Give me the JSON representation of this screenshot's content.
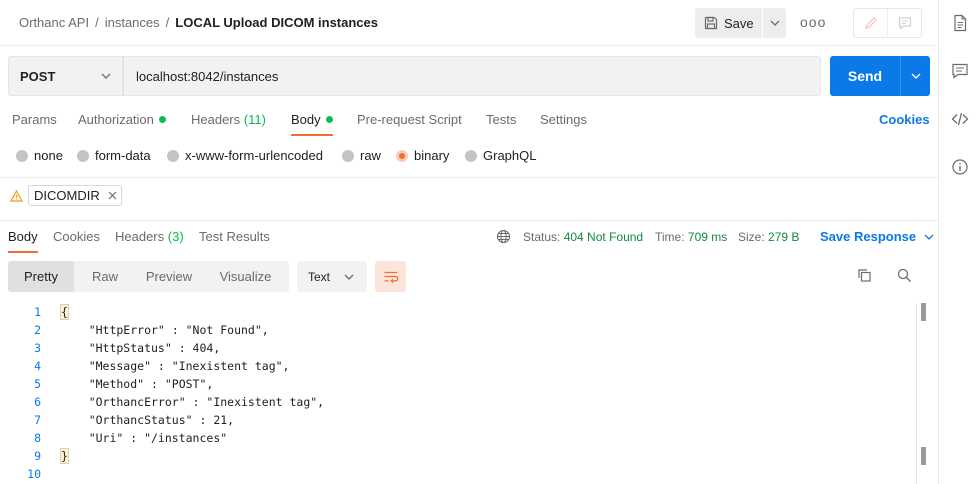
{
  "breadcrumb": {
    "parts": [
      "Orthanc API",
      "instances"
    ],
    "separator": "/",
    "current": "LOCAL Upload DICOM instances"
  },
  "header": {
    "save_label": "Save",
    "more_label": "ooo"
  },
  "request": {
    "method": "POST",
    "url": "localhost:8042/instances",
    "send_label": "Send"
  },
  "request_tabs": [
    {
      "label": "Params"
    },
    {
      "label": "Authorization"
    },
    {
      "label": "Headers",
      "count": "(11)"
    },
    {
      "label": "Body"
    },
    {
      "label": "Pre-request Script"
    },
    {
      "label": "Tests"
    },
    {
      "label": "Settings"
    }
  ],
  "cookies_label": "Cookies",
  "body_types": [
    "none",
    "form-data",
    "x-www-form-urlencoded",
    "raw",
    "binary",
    "GraphQL"
  ],
  "selected_body_type": "binary",
  "file": {
    "name": "DICOMDIR"
  },
  "response_tabs": [
    {
      "label": "Body"
    },
    {
      "label": "Cookies"
    },
    {
      "label": "Headers",
      "count": "(3)"
    },
    {
      "label": "Test Results"
    }
  ],
  "response_meta": {
    "status_label": "Status:",
    "status_value": "404 Not Found",
    "time_label": "Time:",
    "time_value": "709 ms",
    "size_label": "Size:",
    "size_value": "279 B",
    "save_response_label": "Save Response"
  },
  "view_modes": [
    "Pretty",
    "Raw",
    "Preview",
    "Visualize"
  ],
  "active_view": "Pretty",
  "format": "Text",
  "code_lines": [
    {
      "n": "1",
      "text": "{"
    },
    {
      "n": "2",
      "text": "    \"HttpError\" : \"Not Found\","
    },
    {
      "n": "3",
      "text": "    \"HttpStatus\" : 404,"
    },
    {
      "n": "4",
      "text": "    \"Message\" : \"Inexistent tag\","
    },
    {
      "n": "5",
      "text": "    \"Method\" : \"POST\","
    },
    {
      "n": "6",
      "text": "    \"OrthancError\" : \"Inexistent tag\","
    },
    {
      "n": "7",
      "text": "    \"OrthancStatus\" : 21,"
    },
    {
      "n": "8",
      "text": "    \"Uri\" : \"/instances\""
    },
    {
      "n": "9",
      "text": "}"
    },
    {
      "n": "10",
      "text": ""
    }
  ],
  "colors": {
    "accent": "#f26b3a",
    "primary": "#0c79e8",
    "success": "#0cbb52"
  },
  "icons": [
    "save-icon",
    "chevron-down-icon",
    "edit-icon",
    "comment-icon",
    "warning-icon",
    "close-icon",
    "globe-icon",
    "wrap-icon",
    "copy-icon",
    "search-icon",
    "document-icon",
    "code-icon",
    "info-icon"
  ]
}
